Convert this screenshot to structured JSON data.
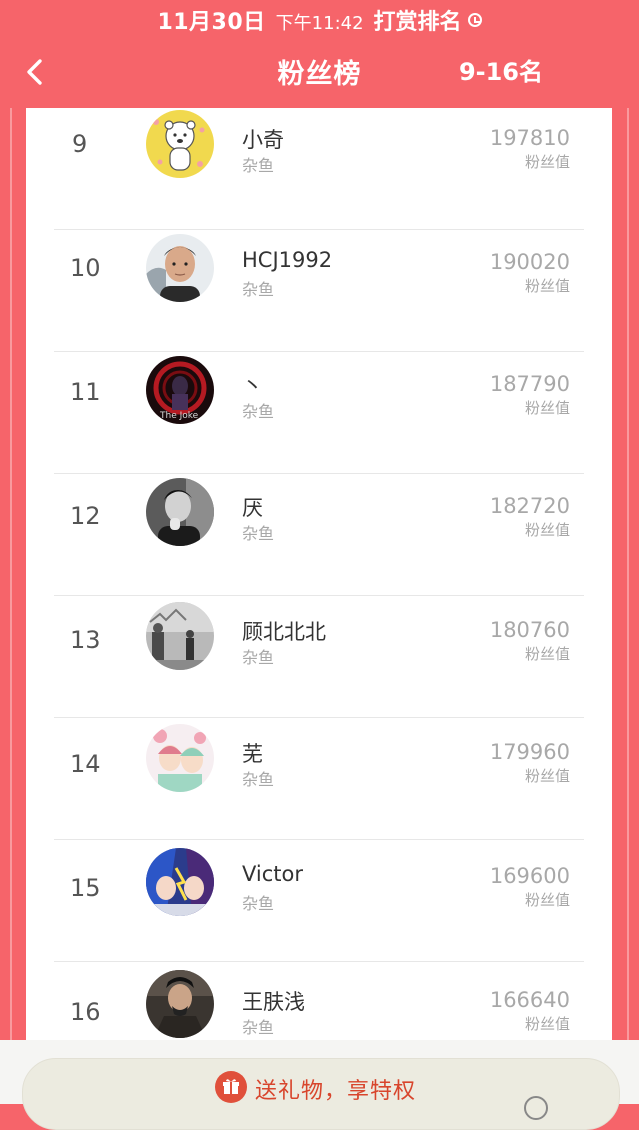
{
  "status": {
    "date": "11月30日",
    "time": "下午11:42",
    "section": "打赏排名"
  },
  "header": {
    "title": "粉丝榜",
    "range": "9-16名"
  },
  "entries": [
    {
      "rank": "9",
      "name": "小奇",
      "level": "杂鱼",
      "score": "197810",
      "unit": "粉丝值"
    },
    {
      "rank": "10",
      "name": "HCJ1992",
      "level": "杂鱼",
      "score": "190020",
      "unit": "粉丝值"
    },
    {
      "rank": "11",
      "name": "丶",
      "level": "杂鱼",
      "score": "187790",
      "unit": "粉丝值"
    },
    {
      "rank": "12",
      "name": "厌",
      "level": "杂鱼",
      "score": "182720",
      "unit": "粉丝值"
    },
    {
      "rank": "13",
      "name": "顾北北北",
      "level": "杂鱼",
      "score": "180760",
      "unit": "粉丝值"
    },
    {
      "rank": "14",
      "name": "芜",
      "level": "杂鱼",
      "score": "179960",
      "unit": "粉丝值"
    },
    {
      "rank": "15",
      "name": "Victor",
      "level": "杂鱼",
      "score": "169600",
      "unit": "粉丝值"
    },
    {
      "rank": "16",
      "name": "王肤浅",
      "level": "杂鱼",
      "score": "166640",
      "unit": "粉丝值"
    }
  ],
  "footer": {
    "gift_label": "送礼物，享特权"
  },
  "colors": {
    "header_bg": "#f6646a",
    "accent_text": "#d8452c"
  }
}
